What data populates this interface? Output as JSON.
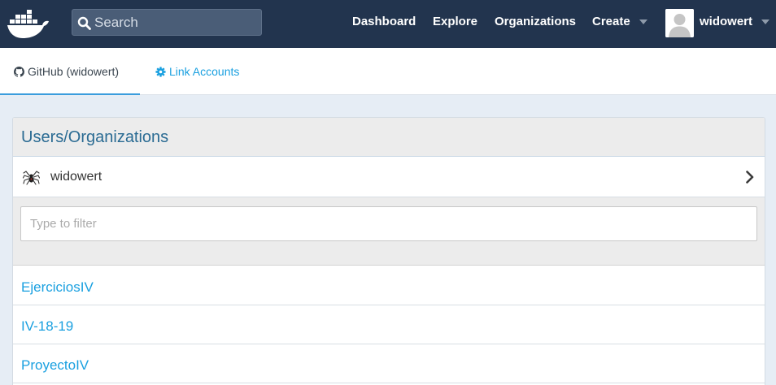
{
  "header": {
    "logo_icon": "docker-whale-icon",
    "search_placeholder": "Search",
    "nav": {
      "dashboard": "Dashboard",
      "explore": "Explore",
      "organizations": "Organizations",
      "create": "Create"
    },
    "username": "widowert"
  },
  "tabs": {
    "github": "GitHub (widowert)",
    "link_accounts": "Link Accounts"
  },
  "panel": {
    "title": "Users/Organizations",
    "account": {
      "name": "widowert",
      "icon": "spider-icon"
    },
    "filter_placeholder": "Type to filter",
    "repos": [
      "EjerciciosIV",
      "IV-18-19",
      "ProyectoIV"
    ]
  },
  "colors": {
    "nav_bg": "#22344e",
    "link": "#1aa0e0",
    "panel_title": "#2a6b93",
    "page_bg": "#e6edf5"
  }
}
